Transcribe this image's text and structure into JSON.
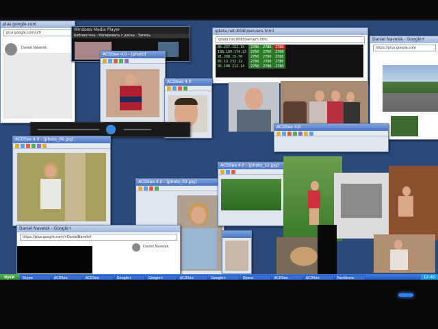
{
  "taskbar": {
    "start_label": "пуск",
    "tasks": [
      "Skype",
      "ACDSee",
      "ACDSee",
      "Google+",
      "Google+",
      "ACDSee",
      "Google+",
      "Opera",
      "ACDSee",
      "ACDSee",
      "FastStone"
    ],
    "clock": "12:40"
  },
  "windows": {
    "gplus_left": {
      "title": "plus.google.com",
      "url": "plus.google.com/u/0",
      "profile_name": "Daniel Navelsk"
    },
    "media_player": {
      "title": "Windows Media Player",
      "menu": [
        "Библиотека",
        "Копировать с диска",
        "Запись"
      ]
    },
    "stats": {
      "title": "qdata.net:8080/servers.html",
      "url": "qdata.net:8080/servers.html",
      "rows": [
        [
          "85.237.152.15",
          "2780",
          "2780",
          "2780"
        ],
        [
          "188.189.174.13",
          "2760",
          "2760",
          "2760"
        ],
        [
          "91.208.15.76",
          "2760",
          "2760",
          "2760"
        ],
        [
          "85.13.232.12",
          "2780",
          "2780",
          "2780"
        ],
        [
          "95.108.212.14",
          "2780",
          "2780",
          "2780"
        ]
      ]
    },
    "acdsee_small": {
      "title": "ACDSee 4.0 - [photo]"
    },
    "acdsee_small2": {
      "title": "ACDSee 4.0"
    },
    "acdsee_main": {
      "title": "ACDSee 4.0 - [photo_06.jpg]"
    },
    "acdsee_green": {
      "title": "ACDSee 4.0 - [photo_12.jpg]"
    },
    "acdsee_center": {
      "title": "ACDSee 4.0"
    },
    "acdsee_portrait": {
      "title": "ACDSee 4.0 - [photo_03.jpg]"
    },
    "gplus_bottom": {
      "title": "Daniel Navelsk - Google+",
      "url": "https://plus.google.com/+DanielNavelsk",
      "profile_name": "Daniel Navelsk"
    },
    "gplus_right": {
      "title": "Daniel Navelsk - Google+",
      "url": "https://plus.google.com"
    }
  },
  "colors": {
    "taskbar": "#245edb",
    "start": "#3c9a3c",
    "titlebar": "#4a74c0",
    "power_led": "#2f7fff"
  }
}
